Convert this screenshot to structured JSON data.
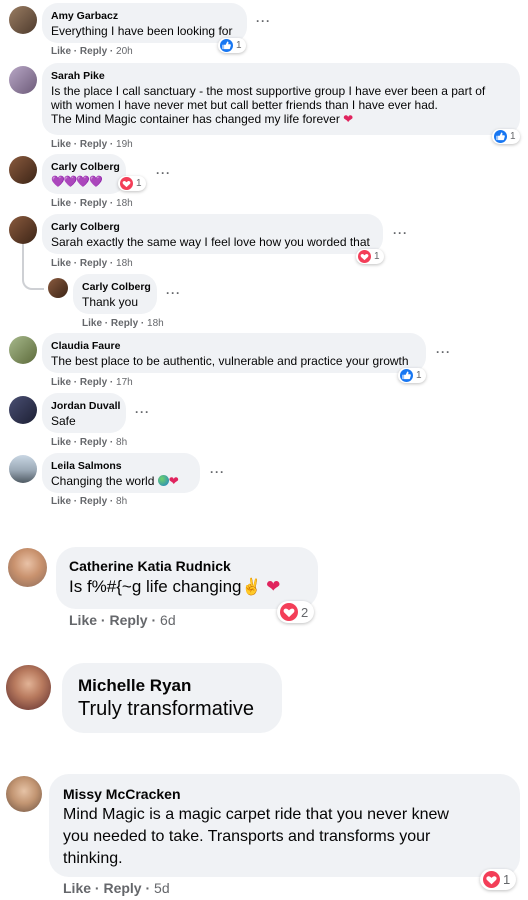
{
  "comments": [
    {
      "name": "Amy Garbacz",
      "text": "Everything I have been looking for",
      "like": "Like",
      "reply": "Reply",
      "time": "20h",
      "reaction": {
        "type": "like",
        "count": "1"
      }
    },
    {
      "name": "Sarah Pike",
      "lines": [
        "Is the place I call sanctuary - the most supportive group I have ever been a part of",
        "with women I have never met but call better friends than I have ever had.",
        "The Mind Magic container has changed my life forever"
      ],
      "like": "Like",
      "reply": "Reply",
      "time": "19h",
      "reaction": {
        "type": "like",
        "count": "1"
      }
    },
    {
      "name": "Carly Colberg",
      "text": "💜💜💜💜",
      "like": "Like",
      "reply": "Reply",
      "time": "18h",
      "reaction": {
        "type": "love",
        "count": "1"
      }
    },
    {
      "name": "Carly Colberg",
      "text": "Sarah exactly the same way I feel love how you worded that",
      "like": "Like",
      "reply": "Reply",
      "time": "18h",
      "reaction": {
        "type": "love",
        "count": "1"
      }
    },
    {
      "name": "Carly Colberg",
      "text": "Thank you",
      "like": "Like",
      "reply": "Reply",
      "time": "18h"
    },
    {
      "name": "Claudia Faure",
      "text": "The best place to be authentic, vulnerable and practice your growth",
      "like": "Like",
      "reply": "Reply",
      "time": "17h",
      "reaction": {
        "type": "like",
        "count": "1"
      }
    },
    {
      "name": "Jordan Duvall",
      "text": "Safe",
      "like": "Like",
      "reply": "Reply",
      "time": "8h"
    },
    {
      "name": "Leila Salmons",
      "text": "Changing the world",
      "like": "Like",
      "reply": "Reply",
      "time": "8h"
    },
    {
      "name": "Catherine Katia Rudnick",
      "text": "Is f%#{~g life changing",
      "like": "Like",
      "reply": "Reply",
      "time": "6d",
      "reaction": {
        "type": "love",
        "count": "2"
      }
    },
    {
      "name": "Michelle Ryan",
      "text": "Truly transformative"
    },
    {
      "name": "Missy McCracken",
      "lines": [
        "Mind Magic is a magic carpet ride that you never knew",
        "you needed to take. Transports and transforms your",
        "thinking."
      ],
      "like": "Like",
      "reply": "Reply",
      "time": "5d",
      "reaction": {
        "type": "love",
        "count": "1"
      }
    }
  ],
  "colors": {
    "bubble": "#f0f2f5",
    "meta": "#65676b",
    "like_blue": "#1877f2",
    "love_red": "#f33e58"
  },
  "icons": {
    "like": "thumbs-up-icon",
    "love": "heart-icon",
    "more": "more-options-icon"
  }
}
